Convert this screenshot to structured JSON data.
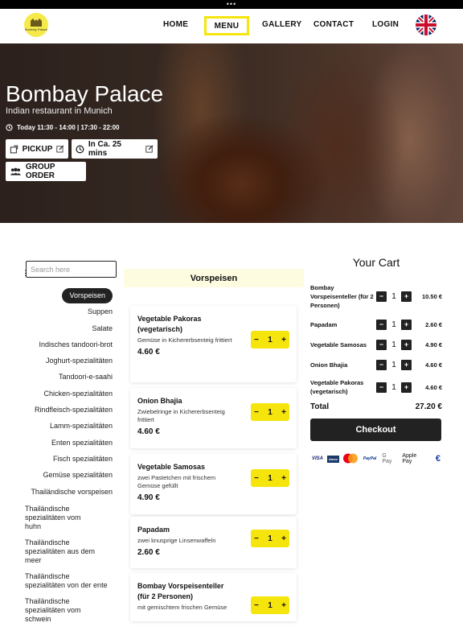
{
  "nav": {
    "logo_text": "Bombay Palace",
    "home": "HOME",
    "menu": "MENU",
    "gallery": "GALLERY",
    "contact": "CONTACT",
    "login": "LOGIN"
  },
  "hero": {
    "title": "Bombay Palace",
    "subtitle": "Indian restaurant in Munich",
    "hours": "Today 11:30 - 14:00 | 17:30 - 22:00",
    "pickup": "PICKUP",
    "time": "In Ca. 25 mins",
    "group_order": "GROUP ORDER"
  },
  "search": {
    "placeholder": "Search here"
  },
  "categories": [
    "Vorspeisen",
    "Suppen",
    "Salate",
    "Indisches tandoori-brot",
    "Joghurt-spezialitäten",
    "Tandoori-e-saahi",
    "Chicken-spezialitäten",
    "Rindfleisch-spezialitäten",
    "Lamm-spezialitäten",
    "Enten spezialitäten",
    "Fisch spezialitäten",
    "Gemüse spezialitäten",
    "Thailändische vorspeisen",
    "Thailändische spezialitäten vom huhn",
    "Thailändische spezialitäten aus dem meer",
    "Thailändische spezialitäten von der ente",
    "Thailändische spezialitäten vom schwein"
  ],
  "menu": {
    "section": "Vorspeisen",
    "items": [
      {
        "name": "Vegetable Pakoras (vegetarisch)",
        "desc": "Gemüse in Kichererbsenteig frittiert",
        "price": "4.60 €",
        "qty": "1"
      },
      {
        "name": "Onion Bhajia",
        "desc": "Zwiebelringe in Kichererbsenteig frittiert",
        "price": "4.60 €",
        "qty": "1"
      },
      {
        "name": "Vegetable Samosas",
        "desc": "zwei Pastetchen mit frischem Gemüse gefüllt",
        "price": "4.90 €",
        "qty": "1"
      },
      {
        "name": "Papadam",
        "desc": "zwei knusprige Linsenwaffeln",
        "price": "2.60 €",
        "qty": "1"
      },
      {
        "name": "Bombay Vorspeisenteller (für 2 Personen)",
        "desc": "mit gemischtem frischen Gemüse",
        "price": "",
        "qty": "1"
      }
    ]
  },
  "cart": {
    "title": "Your Cart",
    "items": [
      {
        "name": "Bombay Vorspeisenteller (für 2 Personen)",
        "qty": "1",
        "price": "10.50 €"
      },
      {
        "name": "Papadam",
        "qty": "1",
        "price": "2.60 €"
      },
      {
        "name": "Vegetable Samosas",
        "qty": "1",
        "price": "4.90 €"
      },
      {
        "name": "Onion Bhajia",
        "qty": "1",
        "price": "4.60 €"
      },
      {
        "name": "Vegetable Pakoras (vegetarisch)",
        "qty": "1",
        "price": "4.60 €"
      }
    ],
    "total_label": "Total",
    "total": "27.20 €",
    "checkout": "Checkout",
    "payments": [
      "VISA",
      "Amex",
      "Mastercard",
      "PayPal",
      "G Pay",
      "Apple Pay",
      "€"
    ]
  },
  "colors": {
    "accent": "#f5e50d",
    "dark": "#222222"
  }
}
